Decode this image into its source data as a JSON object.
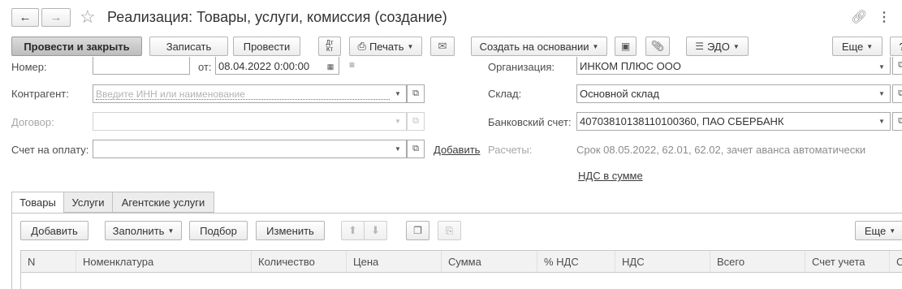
{
  "window": {
    "title": "Реализация: Товары, услуги, комиссия (создание)"
  },
  "toolbar": {
    "post_close": "Провести и закрыть",
    "save": "Записать",
    "post": "Провести",
    "dtkt": "Дт Кт",
    "print": "Печать",
    "create_based": "Создать на основании",
    "edo": "ЭДО",
    "more": "Еще",
    "help": "?"
  },
  "form": {
    "number_label": "Номер:",
    "date_label": "от:",
    "date_value": "08.04.2022  0:00:00",
    "org_label": "Организация:",
    "org_value": "ИНКОМ ПЛЮС ООО",
    "contractor_label": "Контрагент:",
    "contractor_placeholder": "Введите ИНН или наименование",
    "warehouse_label": "Склад:",
    "warehouse_value": "Основной склад",
    "contract_label": "Договор:",
    "bank_label": "Банковский счет:",
    "bank_value": "40703810138110100360, ПАО СБЕРБАНК",
    "invoice_label": "Счет на оплату:",
    "add_link": "Добавить",
    "settlements_label": "Расчеты:",
    "settlements_value": "Срок 08.05.2022, 62.01, 62.02, зачет аванса автоматически",
    "vat_link": "НДС в сумме"
  },
  "tabs": [
    "Товары",
    "Услуги",
    "Агентские услуги"
  ],
  "table_toolbar": {
    "add": "Добавить",
    "fill": "Заполнить",
    "pick": "Подбор",
    "change": "Изменить",
    "more": "Еще"
  },
  "table": {
    "columns": [
      "N",
      "Номенклатура",
      "Количество",
      "Цена",
      "Сумма",
      "% НДС",
      "НДС",
      "Всего",
      "Счет учета",
      "С"
    ]
  }
}
